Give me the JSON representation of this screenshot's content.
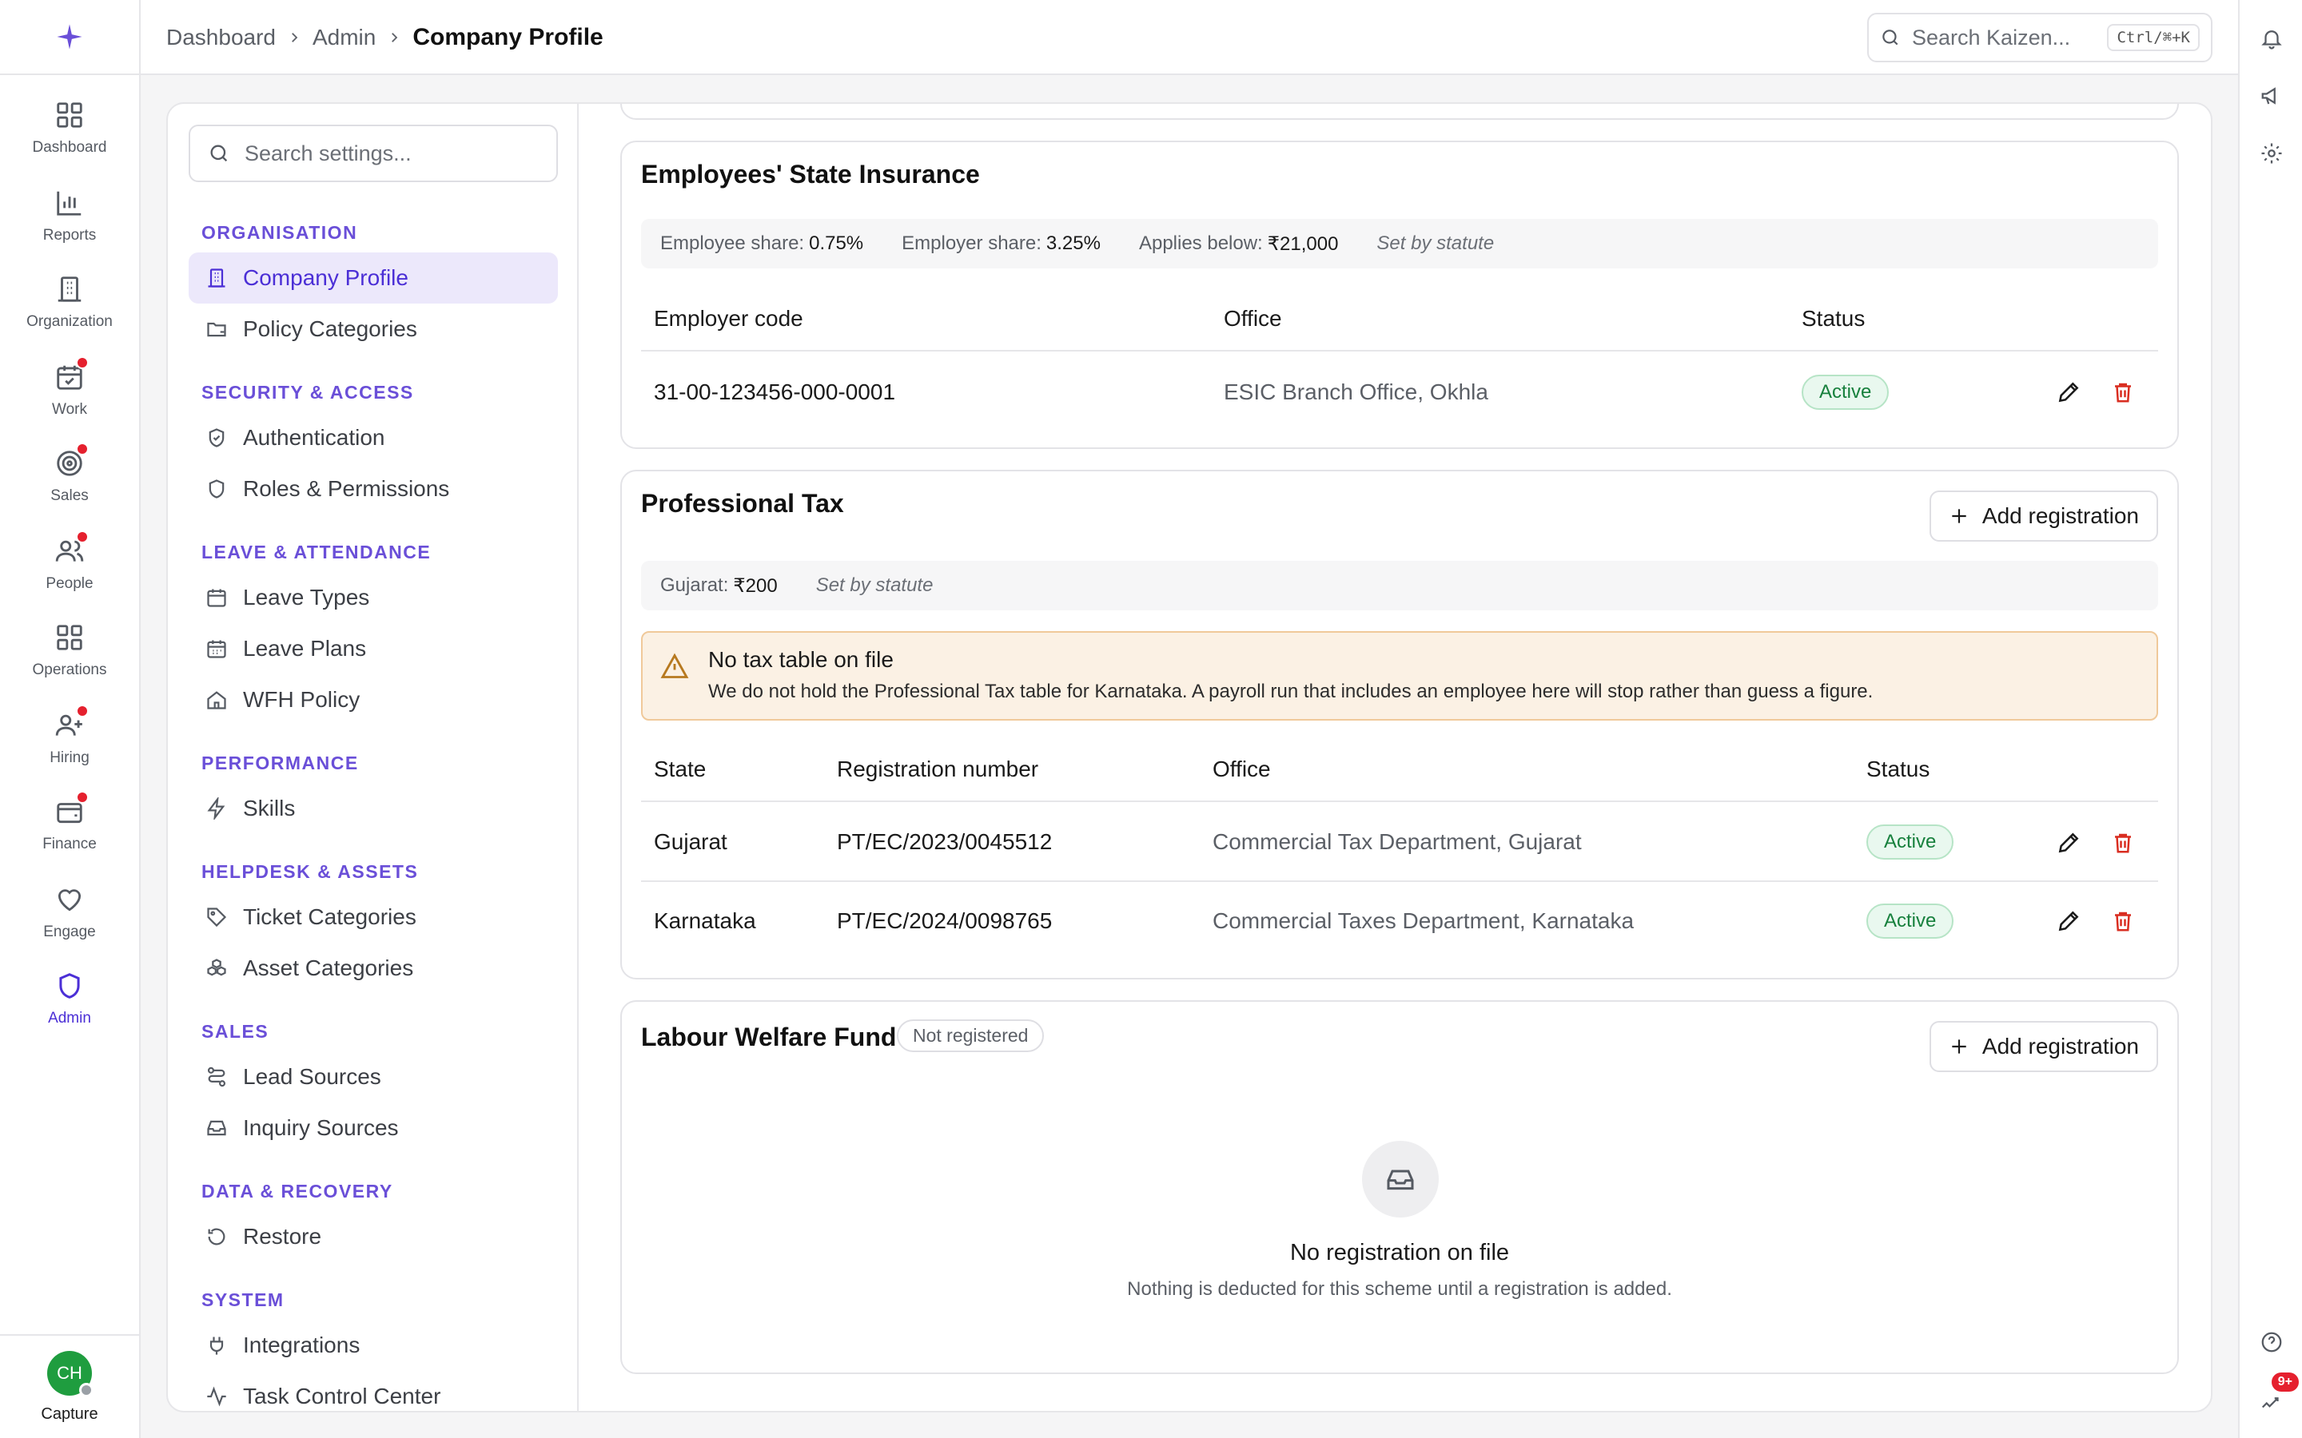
{
  "app": {
    "brand_icon": "sparkle-icon"
  },
  "rail": {
    "items": [
      {
        "label": "Dashboard",
        "icon": "dashboard-icon",
        "dot": false
      },
      {
        "label": "Reports",
        "icon": "bar-chart-icon",
        "dot": false
      },
      {
        "label": "Organization",
        "icon": "building-icon",
        "dot": false
      },
      {
        "label": "Work",
        "icon": "calendar-check-icon",
        "dot": true
      },
      {
        "label": "Sales",
        "icon": "target-icon",
        "dot": true
      },
      {
        "label": "People",
        "icon": "users-icon",
        "dot": true
      },
      {
        "label": "Operations",
        "icon": "grid-icon",
        "dot": false
      },
      {
        "label": "Hiring",
        "icon": "user-plus-icon",
        "dot": true
      },
      {
        "label": "Finance",
        "icon": "wallet-icon",
        "dot": true
      },
      {
        "label": "Engage",
        "icon": "heart-icon",
        "dot": false
      },
      {
        "label": "Admin",
        "icon": "shield-icon",
        "dot": false
      }
    ],
    "user": {
      "initials": "CH",
      "label": "Capture"
    }
  },
  "topbar": {
    "crumbs": [
      "Dashboard",
      "Admin"
    ],
    "current": "Company Profile",
    "search_placeholder": "Search Kaizen...",
    "shortcut": "Ctrl/⌘+K"
  },
  "right_rail": {
    "badge": "9+"
  },
  "settings_nav": {
    "search_placeholder": "Search settings...",
    "groups": {
      "organisation": "ORGANISATION",
      "security": "SECURITY & ACCESS",
      "leave": "LEAVE & ATTENDANCE",
      "performance": "PERFORMANCE",
      "helpdesk": "HELPDESK & ASSETS",
      "sales": "SALES",
      "data": "DATA & RECOVERY",
      "system": "SYSTEM"
    },
    "items": {
      "company_profile": "Company Profile",
      "policy_categories": "Policy Categories",
      "authentication": "Authentication",
      "roles": "Roles & Permissions",
      "leave_types": "Leave Types",
      "leave_plans": "Leave Plans",
      "wfh": "WFH Policy",
      "skills": "Skills",
      "ticket_categories": "Ticket Categories",
      "asset_categories": "Asset Categories",
      "lead_sources": "Lead Sources",
      "inquiry_sources": "Inquiry Sources",
      "restore": "Restore",
      "integrations": "Integrations",
      "task_control": "Task Control Center"
    }
  },
  "esi": {
    "title": "Employees' State Insurance",
    "info": {
      "employee_share_label": "Employee share:",
      "employee_share": "0.75%",
      "employer_share_label": "Employer share:",
      "employer_share": "3.25%",
      "applies_label": "Applies below:",
      "applies": "₹21,000",
      "note": "Set by statute"
    },
    "headers": [
      "Employer code",
      "Office",
      "Status"
    ],
    "row": {
      "code": "31-00-123456-000-0001",
      "office": "ESIC Branch Office, Okhla",
      "status": "Active"
    }
  },
  "pt": {
    "title": "Professional Tax",
    "add_label": "Add registration",
    "info": {
      "label": "Gujarat:",
      "value": "₹200",
      "note": "Set by statute"
    },
    "warning": {
      "title": "No tax table on file",
      "desc": "We do not hold the Professional Tax table for Karnataka. A payroll run that includes an employee here will stop rather than guess a figure."
    },
    "headers": [
      "State",
      "Registration number",
      "Office",
      "Status"
    ],
    "rows": [
      {
        "state": "Gujarat",
        "reg": "PT/EC/2023/0045512",
        "office": "Commercial Tax Department, Gujarat",
        "status": "Active"
      },
      {
        "state": "Karnataka",
        "reg": "PT/EC/2024/0098765",
        "office": "Commercial Taxes Department, Karnataka",
        "status": "Active"
      }
    ]
  },
  "lwf": {
    "title": "Labour Welfare Fund",
    "badge": "Not registered",
    "add_label": "Add registration",
    "empty_title": "No registration on file",
    "empty_desc": "Nothing is deducted for this scheme until a registration is added."
  },
  "colors": {
    "accent": "#4b2fd6",
    "group_label": "#6a4fd8",
    "danger": "#d92d20",
    "success": "#17803d"
  }
}
